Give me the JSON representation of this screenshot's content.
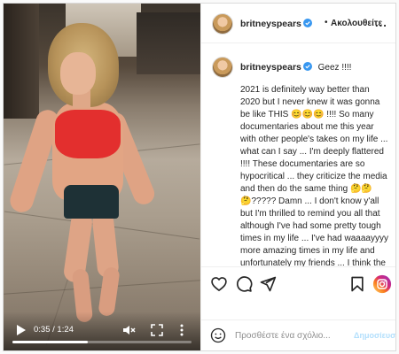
{
  "video": {
    "current_time": "0:35",
    "duration": "1:24",
    "time_separator": " / ",
    "progress": 0.42
  },
  "header": {
    "username": "britneyspears",
    "dot": "•",
    "follow_label": "Ακολουθείτε",
    "more": "..."
  },
  "caption": {
    "username": "britneyspears",
    "title": "Geez !!!!",
    "body": "2021 is definitely way better than 2020 but I never knew it was gonna be like THIS 😊😊😊 !!!! So many documentaries about me this year with other people's takes on my life ... what can I say ... I'm deeply flattered !!!! These documentaries are so hypocritical ... they criticize the media and then do the same thing 🤔🤔🤔????? Damn ... I don't know y'all but I'm thrilled to remind you all that although I've had some pretty tough times in my life ... I've had waaaayyyy more amazing times in my life and unfortunately my friends ... I think the world is more interested in the negative 😱😱😱 !!!! I mean ... isn't this supposed to be a business and"
  },
  "actions": {
    "icons": [
      "heart-icon",
      "comment-icon",
      "share-icon",
      "bookmark-icon",
      "instagram-icon"
    ]
  },
  "comment": {
    "placeholder": "Προσθέστε ένα σχόλιο...",
    "post_label": "Δημοσίευση"
  },
  "colors": {
    "verified": "#3897f0",
    "post_disabled": "#b2dffc",
    "top_red": "#e32f2e"
  }
}
